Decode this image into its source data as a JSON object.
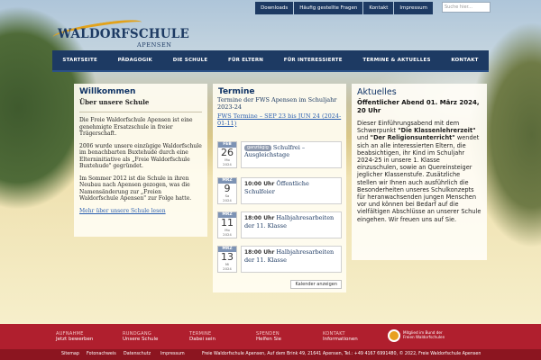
{
  "top_nav": {
    "items": [
      "Downloads",
      "Häufig gestellte Fragen",
      "Kontakt",
      "Impressum"
    ],
    "search_placeholder": "Suche hier..."
  },
  "logo": {
    "main": "WALDORFSCHULE",
    "sub": "APENSEN"
  },
  "main_nav": [
    "STARTSEITE",
    "PÄDAGOGIK",
    "DIE SCHULE",
    "FÜR ELTERN",
    "FÜR INTERESSIERTE",
    "TERMINE & AKTUELLES",
    "KONTAKT"
  ],
  "welcome": {
    "title": "Willkommen",
    "subtitle": "Über unsere Schule",
    "paragraphs": [
      "Die Freie Waldorfschule Apensen ist eine genehmigte Ersatzschule in freier Trägerschaft.",
      "2006 wurde unsere einzügige Waldorfschule im benachbarten Buxtehude durch eine Elterninitiative als „Freie Waldorfschule Buxtehude\" gegründet.",
      "Im Sommer 2012 ist die Schule in ihren Neubau nach Apensen gezogen, was die Namensänderung zur „Freien Waldorfschule Apensen\" zur Folge hatte."
    ],
    "link": "Mehr über unsere Schule lesen"
  },
  "termine": {
    "title": "Termine",
    "intro": "Termine der FWS Apensen im Schuljahr 2023-24",
    "link": "FWS Termine – SEP 23 bis JUN 24 (2024-01-11)",
    "events": [
      {
        "month": "FEB",
        "day": "26",
        "weekday": "Mo",
        "year": "2024",
        "tag": "ganztägig",
        "time": "",
        "text": "Schulfrei – Ausgleichstage"
      },
      {
        "month": "MRZ",
        "day": "9",
        "weekday": "Sa",
        "year": "2024",
        "tag": "",
        "time": "10:00 Uhr",
        "text": "Öffentliche Schulfeier"
      },
      {
        "month": "MRZ",
        "day": "11",
        "weekday": "Mo",
        "year": "2024",
        "tag": "",
        "time": "18:00 Uhr",
        "text": "Halbjahresarbeiten der 11. Klasse"
      },
      {
        "month": "MRZ",
        "day": "13",
        "weekday": "Mi",
        "year": "2024",
        "tag": "",
        "time": "18:00 Uhr",
        "text": "Halbjahresarbeiten der 11. Klasse"
      }
    ],
    "button": "Kalender anzeigen"
  },
  "news": {
    "title": "Aktuelles",
    "headline": "Öffentlicher Abend 01. März 2024, 20 Uhr",
    "body_start": "Dieser Einführungsabend mit dem Schwerpunkt ",
    "bold1": "\"Die Klassenlehrerzeit\"",
    "mid1": " und ",
    "bold2": "\"Der Religionsunterricht\"",
    "body_end": " wendet sich an alle interessierten Eltern, die beabsichtigen, ihr Kind im Schuljahr 2024-25 in unsere 1. Klasse einzuschulen, sowie an Quereinsteiger jeglicher Klassenstufe. Zusätzliche stellen wir Ihnen auch ausführlich die Besonderheiten unseres Schulkonzepts für heranwachsenden jungen Menschen vor und können bei Bedarf auf die vielfältigen Abschlüsse an unserer Schule eingehen. Wir freuen uns auf Sie."
  },
  "footer": {
    "items": [
      {
        "title": "AUFNAHME",
        "sub": "Jetzt bewerben"
      },
      {
        "title": "RUNDGANG",
        "sub": "Unsere Schule"
      },
      {
        "title": "TERMINE",
        "sub": "Dabei sein"
      },
      {
        "title": "SPENDEN",
        "sub": "Helfen Sie"
      },
      {
        "title": "KONTAKT",
        "sub": "Informationen"
      }
    ],
    "badge_line1": "Mitglied im Bund der",
    "badge_line2": "Freien Waldorfschulen"
  },
  "bottom_bar": {
    "links": [
      "Sitemap",
      "Fotonachweis",
      "Datenschutz",
      "Impressum"
    ],
    "address": "Freie Waldorfschule Apensen, Auf dem Brink 49, 21641 Apensen, Tel.: +49 4167 6991480, © 2022, Freie Waldorfschule Apensen"
  },
  "colors": {
    "navy": "#1d3a63",
    "footer_red": "#b01f2e",
    "link_blue": "#2a5eb0",
    "accent_yellow": "#e2a21b"
  }
}
